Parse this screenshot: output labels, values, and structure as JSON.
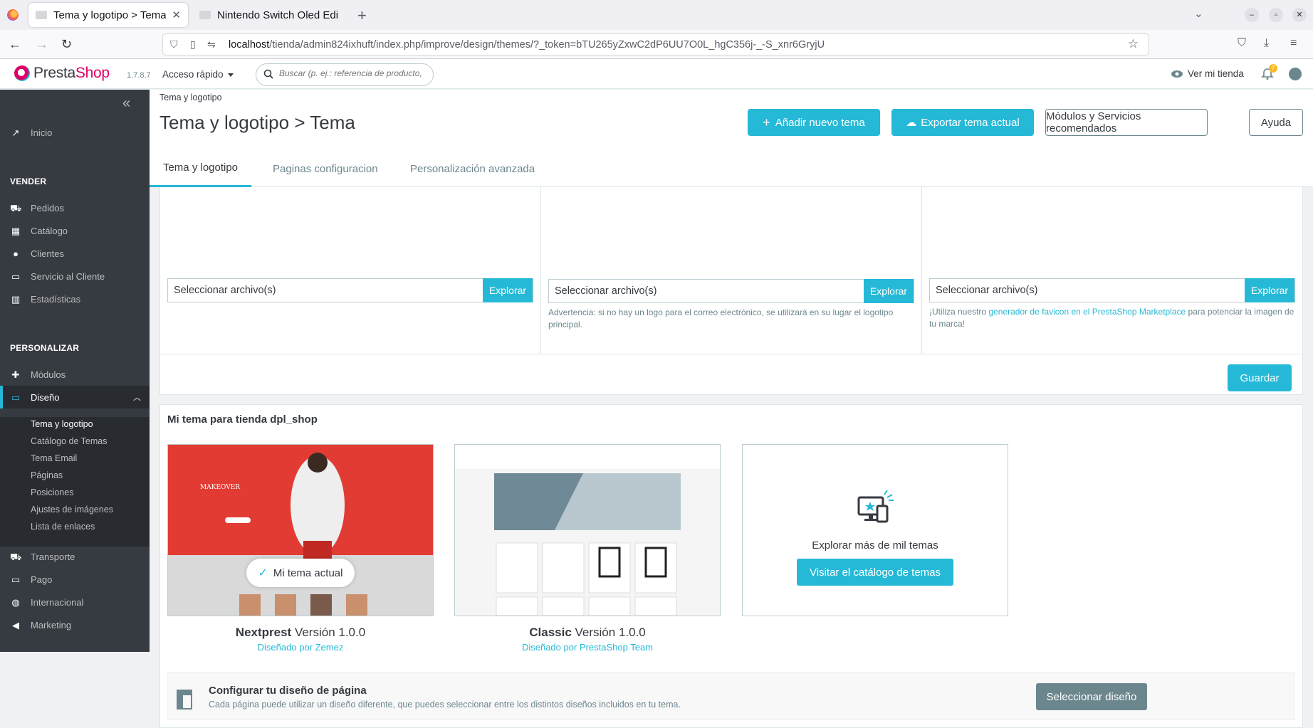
{
  "browser": {
    "tabs": [
      {
        "title": "Tema y logotipo > Tema • Cp",
        "active": true
      },
      {
        "title": "Nintendo Switch Oled Edi",
        "active": false
      }
    ],
    "url_host": "localhost",
    "url_path": "/tienda/admin824ixhuft/index.php/improve/design/themes/?_token=bTU265yZxwC2dP6UU7O0L_hgC356j-_-S_xnr6GryjU"
  },
  "header": {
    "brand_presta": "Presta",
    "brand_shop": "Shop",
    "version": "1.7.8.7",
    "quick_access": "Acceso rápido",
    "search_placeholder": "Buscar (p. ej.: referencia de producto,",
    "view_shop": "Ver mi tienda",
    "notifications_count": "7"
  },
  "sidebar": {
    "home": "Inicio",
    "section_sell": "VENDER",
    "orders": "Pedidos",
    "catalog": "Catálogo",
    "customers": "Clientes",
    "customer_service": "Servicio al Cliente",
    "stats": "Estadísticas",
    "section_customize": "PERSONALIZAR",
    "modules": "Módulos",
    "design": "Diseño",
    "design_sub": [
      "Tema y logotipo",
      "Catálogo de Temas",
      "Tema Email",
      "Páginas",
      "Posiciones",
      "Ajustes de imágenes",
      "Lista de enlaces"
    ],
    "shipping": "Transporte",
    "payment": "Pago",
    "international": "Internacional",
    "marketing": "Marketing"
  },
  "page": {
    "breadcrumb": "Tema y logotipo",
    "title": "Tema y logotipo > Tema",
    "btn_add_theme": "Añadir nuevo tema",
    "btn_export_theme": "Exportar tema actual",
    "btn_modules": "Módulos y Servicios recomendados",
    "btn_help": "Ayuda",
    "tabs": [
      "Tema y logotipo",
      "Paginas configuracion",
      "Personalización avanzada"
    ]
  },
  "logos": {
    "file_placeholder": "Seleccionar archivo(s)",
    "browse": "Explorar",
    "mail_help": "Advertencia: si no hay un logo para el correo electrónico, se utilizará en su lugar el logotipo principal.",
    "favicon_help_pre": "¡Utiliza nuestro ",
    "favicon_help_link": "generador de favicon en el PrestaShop Marketplace",
    "favicon_help_post": " para potenciar la imagen de tu marca!",
    "save": "Guardar"
  },
  "themes": {
    "title": "Mi tema para tienda dpl_shop",
    "current_label": "Mi tema actual",
    "items": [
      {
        "name": "Nextprest",
        "version": "Versión 1.0.0",
        "author": "Diseñado por Zemez"
      },
      {
        "name": "Classic",
        "version": "Versión 1.0.0",
        "author": "Diseñado por PrestaShop Team"
      }
    ],
    "explore_text": "Explorar más de mil temas",
    "explore_btn": "Visitar el catálogo de temas"
  },
  "layout": {
    "title": "Configurar tu diseño de página",
    "desc": "Cada página puede utilizar un diseño diferente, que puedes seleccionar entre los distintos diseños incluidos en tu tema.",
    "btn": "Seleccionar diseño"
  },
  "colors": {
    "accent": "#25b9d7",
    "sidebar": "#363a41",
    "brand_pink": "#df0067"
  }
}
